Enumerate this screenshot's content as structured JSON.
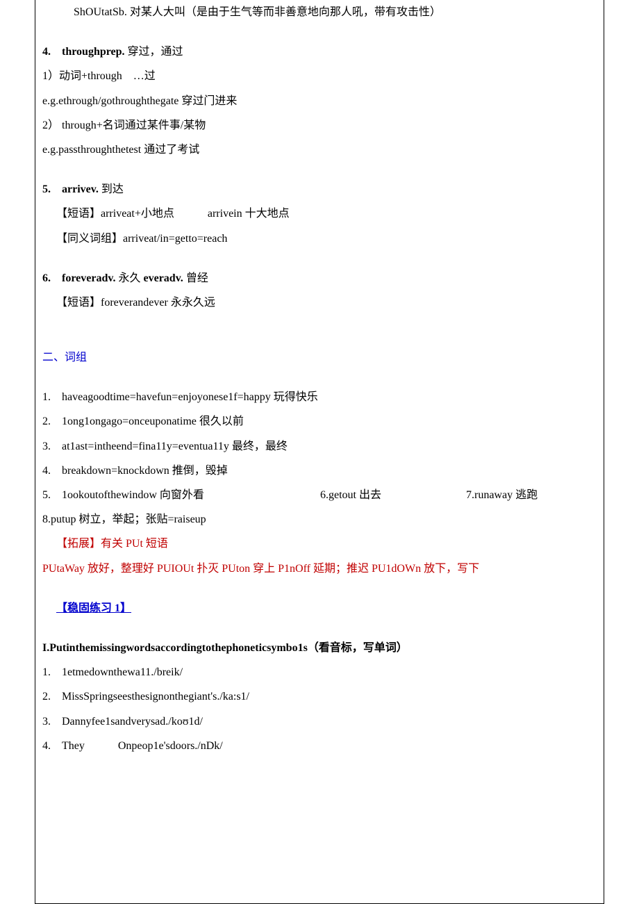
{
  "top_line": "ShOUtatSb. 对某人大叫（是由于生气等而非善意地向那人吼，带有攻击性）",
  "item4": {
    "num": "4.",
    "head": "throughprep.",
    "tail": "穿过，通过",
    "sub1": "1）动词+through …过",
    "sub2": "e.g.ethrough/gothroughthegate 穿过门进来",
    "sub3": "2） through+名词通过某件事/某物",
    "sub4": "e.g.passthroughthetest 通过了考试"
  },
  "item5": {
    "num": "5.",
    "head": "arrivev.",
    "tail": "到达",
    "sub1": "【短语】arriveat+小地点   arrivein 十大地点",
    "sub2": "【同义词组】arriveat/in=getto=reach"
  },
  "item6": {
    "num": "6.",
    "head": "foreveradv.",
    "mid": "永久 ",
    "head2": "everadv.",
    "tail": "曾经",
    "sub1": "【短语】foreverandever 永永久远"
  },
  "section2": {
    "title": "二、词组",
    "p1": "1. haveagoodtime=havefun=enjoyonese1f=happy 玩得快乐",
    "p2": "2. 1ong1ongago=onceuponatime 很久以前",
    "p3": "3. at1ast=intheend=fina11y=eventua11y 最终，最终",
    "p4": "4. breakdown=knockdown 推倒，毁掉",
    "p5a": "5. 1ookoutofthewindow 向窗外看",
    "p5b": "6.getout 出去",
    "p5c": "7.runaway 逃跑",
    "p8": "8.putup 树立，举起；张贴=raiseup",
    "ext_label": "【拓展】有关 PUt 短语",
    "ext_line": "PUtaWay 放好，整理好 PUIOUt 扑灭 PUton 穿上 P1nOff 延期；推迟 PU1dOWn 放下，写下"
  },
  "practice": {
    "title": "【稳固练习 1】",
    "head": "I.Putinthemissingwordsaccordingtothephoneticsymbo1s（看音标，写单词）",
    "q1": "1. 1etmedownthewa11./breik/",
    "q2": "2. MissSpringseesthesignonthegiant's./ka:s1/",
    "q3": "3. Dannyfee1sandverysad./koʊ1d/",
    "q4": "4. They   Onpeop1e'sdoors./nDk/"
  }
}
